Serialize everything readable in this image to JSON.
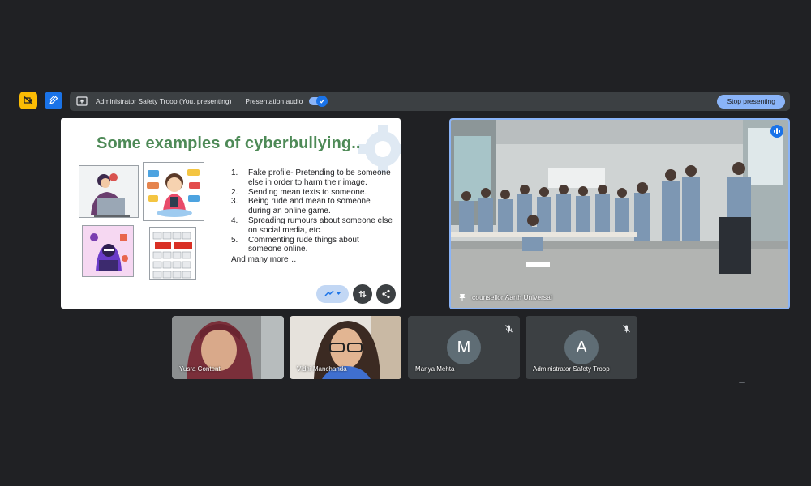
{
  "controls": {
    "left_icons": [
      "camera-off-icon",
      "pen-icon"
    ]
  },
  "presenting_bar": {
    "presenter_label": "Administrator Safety Troop (You, presenting)",
    "audio_label": "Presentation audio",
    "audio_enabled": true,
    "stop_label": "Stop presenting"
  },
  "slide": {
    "title": "Some examples of cyberbullying..",
    "items": [
      {
        "num": "1.",
        "text": "Fake profile- Pretending to be someone else in order to harm their image."
      },
      {
        "num": "2.",
        "text": "Sending mean texts to someone."
      },
      {
        "num": "3.",
        "text": "Being rude and mean to someone during an online game."
      },
      {
        "num": "4.",
        "text": "Spreading rumours about someone else on social media, etc."
      },
      {
        "num": "5.",
        "text": "Commenting rude things about someone online."
      }
    ],
    "footer": "And many more…",
    "controls": [
      "reactions-icon",
      "swap-icon",
      "share-icon"
    ]
  },
  "main_camera": {
    "name": "counsellor Aarth Universal",
    "speaking": true
  },
  "tiles": [
    {
      "name": "Yusra Content",
      "video": true
    },
    {
      "name": "Vidhi Manchanda",
      "video": true
    },
    {
      "name": "Manya Mehta",
      "initial": "M",
      "muted": true
    },
    {
      "name": "Administrator Safety Troop",
      "initial": "A",
      "muted": true
    }
  ],
  "colors": {
    "background": "#202124",
    "bar": "#3c4043",
    "accent": "#8ab4f8",
    "slide_title": "#4e8a57"
  }
}
